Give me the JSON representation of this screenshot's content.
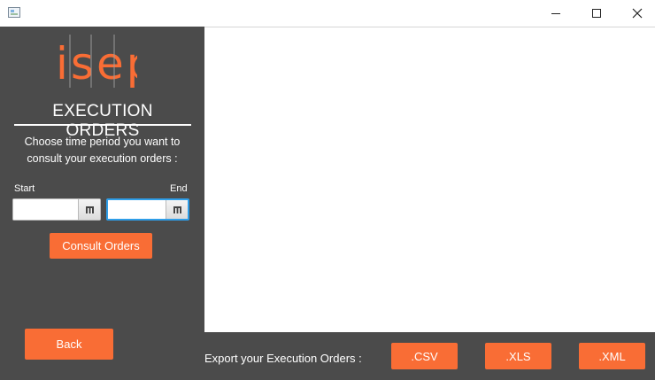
{
  "window": {
    "minimize_icon": "minimize-icon",
    "maximize_icon": "maximize-icon",
    "close_icon": "close-icon"
  },
  "sidebar": {
    "logo_text": "isep",
    "heading": "EXECUTION ORDERS",
    "instructions": "Choose time period you want to consult your execution orders :",
    "start_label": "Start",
    "end_label": "End",
    "start_value": "",
    "end_value": "",
    "calendar_icon": "calendar-icon",
    "consult_button": "Consult Orders",
    "back_button": "Back"
  },
  "bottom": {
    "export_label": "Export your Execution Orders :",
    "csv_button": ".CSV",
    "xls_button": ".XLS",
    "xml_button": ".XML"
  },
  "colors": {
    "accent": "#f96d35",
    "panel": "#4b4b4b",
    "focus": "#2f9ee8"
  }
}
